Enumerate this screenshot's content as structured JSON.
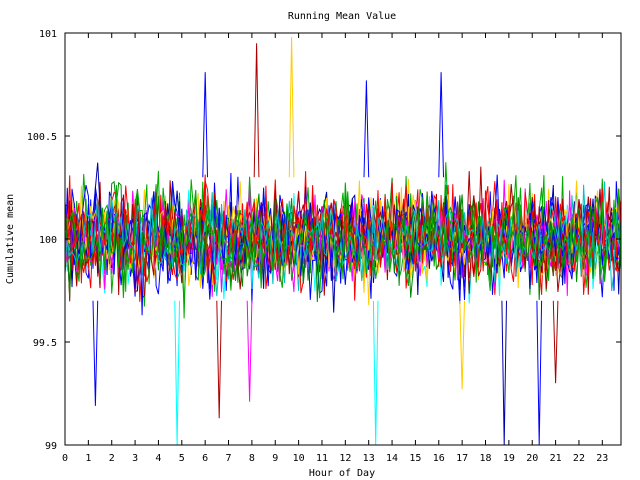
{
  "chart_data": {
    "type": "line",
    "title": "Running Mean Value",
    "xlabel": "Hour of Day",
    "ylabel": "Cumulative mean",
    "xlim": [
      0,
      23.8
    ],
    "ylim": [
      99,
      101
    ],
    "x_ticks": [
      0,
      1,
      2,
      3,
      4,
      5,
      6,
      7,
      8,
      9,
      10,
      11,
      12,
      13,
      14,
      15,
      16,
      17,
      18,
      19,
      20,
      21,
      22,
      23
    ],
    "x_tick_labels": [
      "0",
      "1",
      "2",
      "3",
      "4",
      "5",
      "6",
      "7",
      "8",
      "9",
      "10",
      "11",
      "12",
      "13",
      "14",
      "15",
      "16",
      "17",
      "18",
      "19",
      "20",
      "21",
      "22",
      "23"
    ],
    "y_ticks": [
      99,
      99.5,
      100,
      100.5,
      101
    ],
    "y_tick_labels": [
      "99",
      "99.5",
      "100",
      "100.5",
      "101"
    ],
    "grid": false,
    "legend": "none",
    "sample_step_hours": 0.1,
    "series_colors": [
      "#ff0000",
      "#00aa00",
      "#0000ff",
      "#ff00ff",
      "#00ffff",
      "#ffcc00",
      "#aa0000",
      "#008800",
      "#0000aa",
      "#00c0c0",
      "#000000",
      "#cc00cc"
    ],
    "series": [
      {
        "color": "#ff0000",
        "mean": 100.0,
        "spread": 0.22,
        "seed": 11
      },
      {
        "color": "#00aa00",
        "mean": 100.0,
        "spread": 0.22,
        "seed": 23
      },
      {
        "color": "#0000ff",
        "mean": 100.0,
        "spread": 0.24,
        "seed": 37
      },
      {
        "color": "#ff00ff",
        "mean": 100.0,
        "spread": 0.2,
        "seed": 41
      },
      {
        "color": "#00ffff",
        "mean": 100.0,
        "spread": 0.2,
        "seed": 53
      },
      {
        "color": "#ffcc00",
        "mean": 100.0,
        "spread": 0.2,
        "seed": 67
      },
      {
        "color": "#aa0000",
        "mean": 100.0,
        "spread": 0.22,
        "seed": 71
      },
      {
        "color": "#008800",
        "mean": 100.0,
        "spread": 0.2,
        "seed": 83
      },
      {
        "color": "#0000aa",
        "mean": 100.0,
        "spread": 0.22,
        "seed": 97
      },
      {
        "color": "#ff0000",
        "mean": 100.0,
        "spread": 0.2,
        "seed": 101
      },
      {
        "color": "#00aa00",
        "mean": 100.0,
        "spread": 0.2,
        "seed": 113
      },
      {
        "color": "#0000ff",
        "mean": 100.0,
        "spread": 0.2,
        "seed": 127
      },
      {
        "color": "#ff00ff",
        "mean": 100.0,
        "spread": 0.18,
        "seed": 131
      },
      {
        "color": "#ffcc00",
        "mean": 100.0,
        "spread": 0.18,
        "seed": 149
      },
      {
        "color": "#aa0000",
        "mean": 100.0,
        "spread": 0.2,
        "seed": 151
      },
      {
        "color": "#008800",
        "mean": 100.0,
        "spread": 0.18,
        "seed": 163
      },
      {
        "color": "#0000ff",
        "mean": 100.0,
        "spread": 0.2,
        "seed": 173
      },
      {
        "color": "#ff0000",
        "mean": 100.0,
        "spread": 0.2,
        "seed": 181
      },
      {
        "color": "#00c0c0",
        "mean": 100.0,
        "spread": 0.18,
        "seed": 191
      },
      {
        "color": "#00aa00",
        "mean": 100.0,
        "spread": 0.2,
        "seed": 197
      }
    ],
    "extremes": [
      {
        "color": "#ffcc00",
        "x": 9.7,
        "y": 100.98
      },
      {
        "color": "#aa0000",
        "x": 8.2,
        "y": 100.95
      },
      {
        "color": "#0000ff",
        "x": 6.0,
        "y": 100.81
      },
      {
        "color": "#0000ff",
        "x": 16.1,
        "y": 100.81
      },
      {
        "color": "#0000ff",
        "x": 12.9,
        "y": 100.77
      },
      {
        "color": "#aa0000",
        "x": 6.6,
        "y": 99.13
      },
      {
        "color": "#0000ff",
        "x": 1.3,
        "y": 99.19
      },
      {
        "color": "#ff00ff",
        "x": 7.9,
        "y": 99.21
      },
      {
        "color": "#00ffff",
        "x": 4.8,
        "y": 99.0
      },
      {
        "color": "#00ffff",
        "x": 13.3,
        "y": 99.0
      },
      {
        "color": "#0000aa",
        "x": 18.8,
        "y": 99.0
      },
      {
        "color": "#0000ff",
        "x": 20.3,
        "y": 99.0
      },
      {
        "color": "#aa0000",
        "x": 21.0,
        "y": 99.3
      },
      {
        "color": "#ffcc00",
        "x": 17.0,
        "y": 99.27
      }
    ]
  }
}
